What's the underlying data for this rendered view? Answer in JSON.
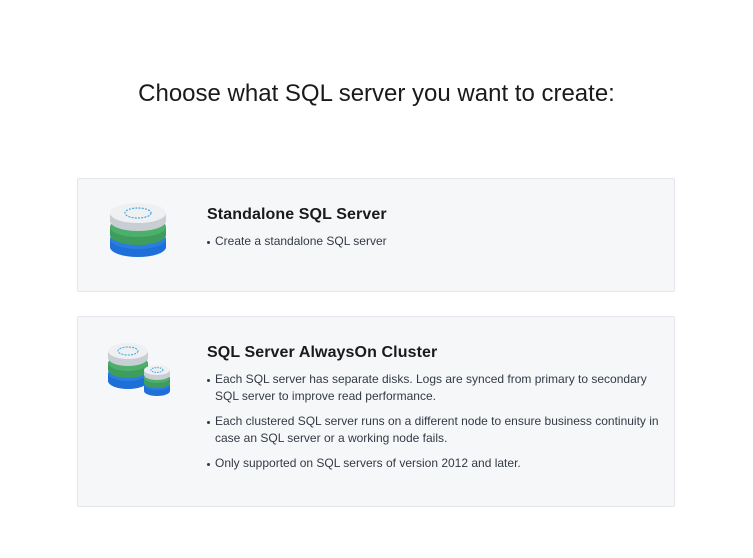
{
  "title": "Choose what SQL server you want to create:",
  "options": [
    {
      "icon": "database-stack-icon",
      "title": "Standalone SQL Server",
      "bullets": [
        "Create a standalone SQL server"
      ]
    },
    {
      "icon": "database-cluster-icon",
      "title": "SQL Server AlwaysOn Cluster",
      "bullets": [
        "Each SQL server has separate disks. Logs are synced from primary to secondary SQL server to improve read performance.",
        "Each clustered SQL server runs on a different node to ensure business continuity in case an SQL server or a working node fails.",
        "Only supported on SQL servers of version 2012 and later."
      ]
    }
  ],
  "colors": {
    "card_bg": "#f6f7f9",
    "card_border": "#e3e6ea",
    "disk_top": "#eef0f2",
    "disk_ring": "#4aa8e0",
    "disk_green": "#4caf6a",
    "disk_blue": "#2a7de1"
  }
}
